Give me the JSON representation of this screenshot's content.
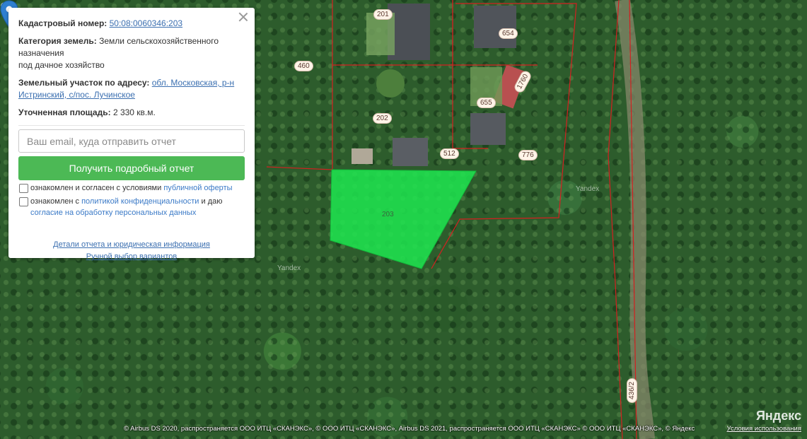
{
  "panel": {
    "cadastral_label": "Кадастровый номер:",
    "cadastral_number": "50:08:0060346:203",
    "category_label": "Категория земель:",
    "category_value_line1": "Земли сельскохозяйственного назначения",
    "category_value_line2": "под дачное хозяйство",
    "address_label": "Земельный участок по адресу:",
    "address_value": "обл. Московская, р-н Истринский, с/пос. Лучинское",
    "area_label": "Уточненная площадь:",
    "area_value": "2 330 кв.м.",
    "email_placeholder": "Ваш email, куда отправить отчет",
    "submit_label": "Получить подробный отчет",
    "consent1_text": "ознакомлен и согласен с условиями",
    "consent1_link": "публичной оферты",
    "consent2_text_a": "ознакомлен с",
    "consent2_link_a": "политикой конфиденциальности",
    "consent2_text_b": "и даю",
    "consent2_link_b": "согласие на обработку персональных данных",
    "details_link": "Детали отчета и юридическая информация",
    "manual_link": "Ручной выбор вариантов"
  },
  "map": {
    "parcel_labels": [
      "201",
      "654",
      "460",
      "1760",
      "655",
      "202",
      "512",
      "776",
      "203",
      "436/2"
    ],
    "watermarks": [
      "Yandex",
      "Yandex"
    ],
    "highlight_color": "#1ee650",
    "marker_color": "#2f7fd0",
    "attribution": "© Airbus DS 2020, распространяется ООО ИТЦ «СКАНЭКС», © ООО ИТЦ «СКАНЭКС», Airbus DS 2021, распространяется ООО ИТЦ «СКАНЭКС» © ООО ИТЦ «СКАНЭКС», © Яндекс",
    "terms_link": "Условия использования",
    "brand": "Яндекс"
  }
}
